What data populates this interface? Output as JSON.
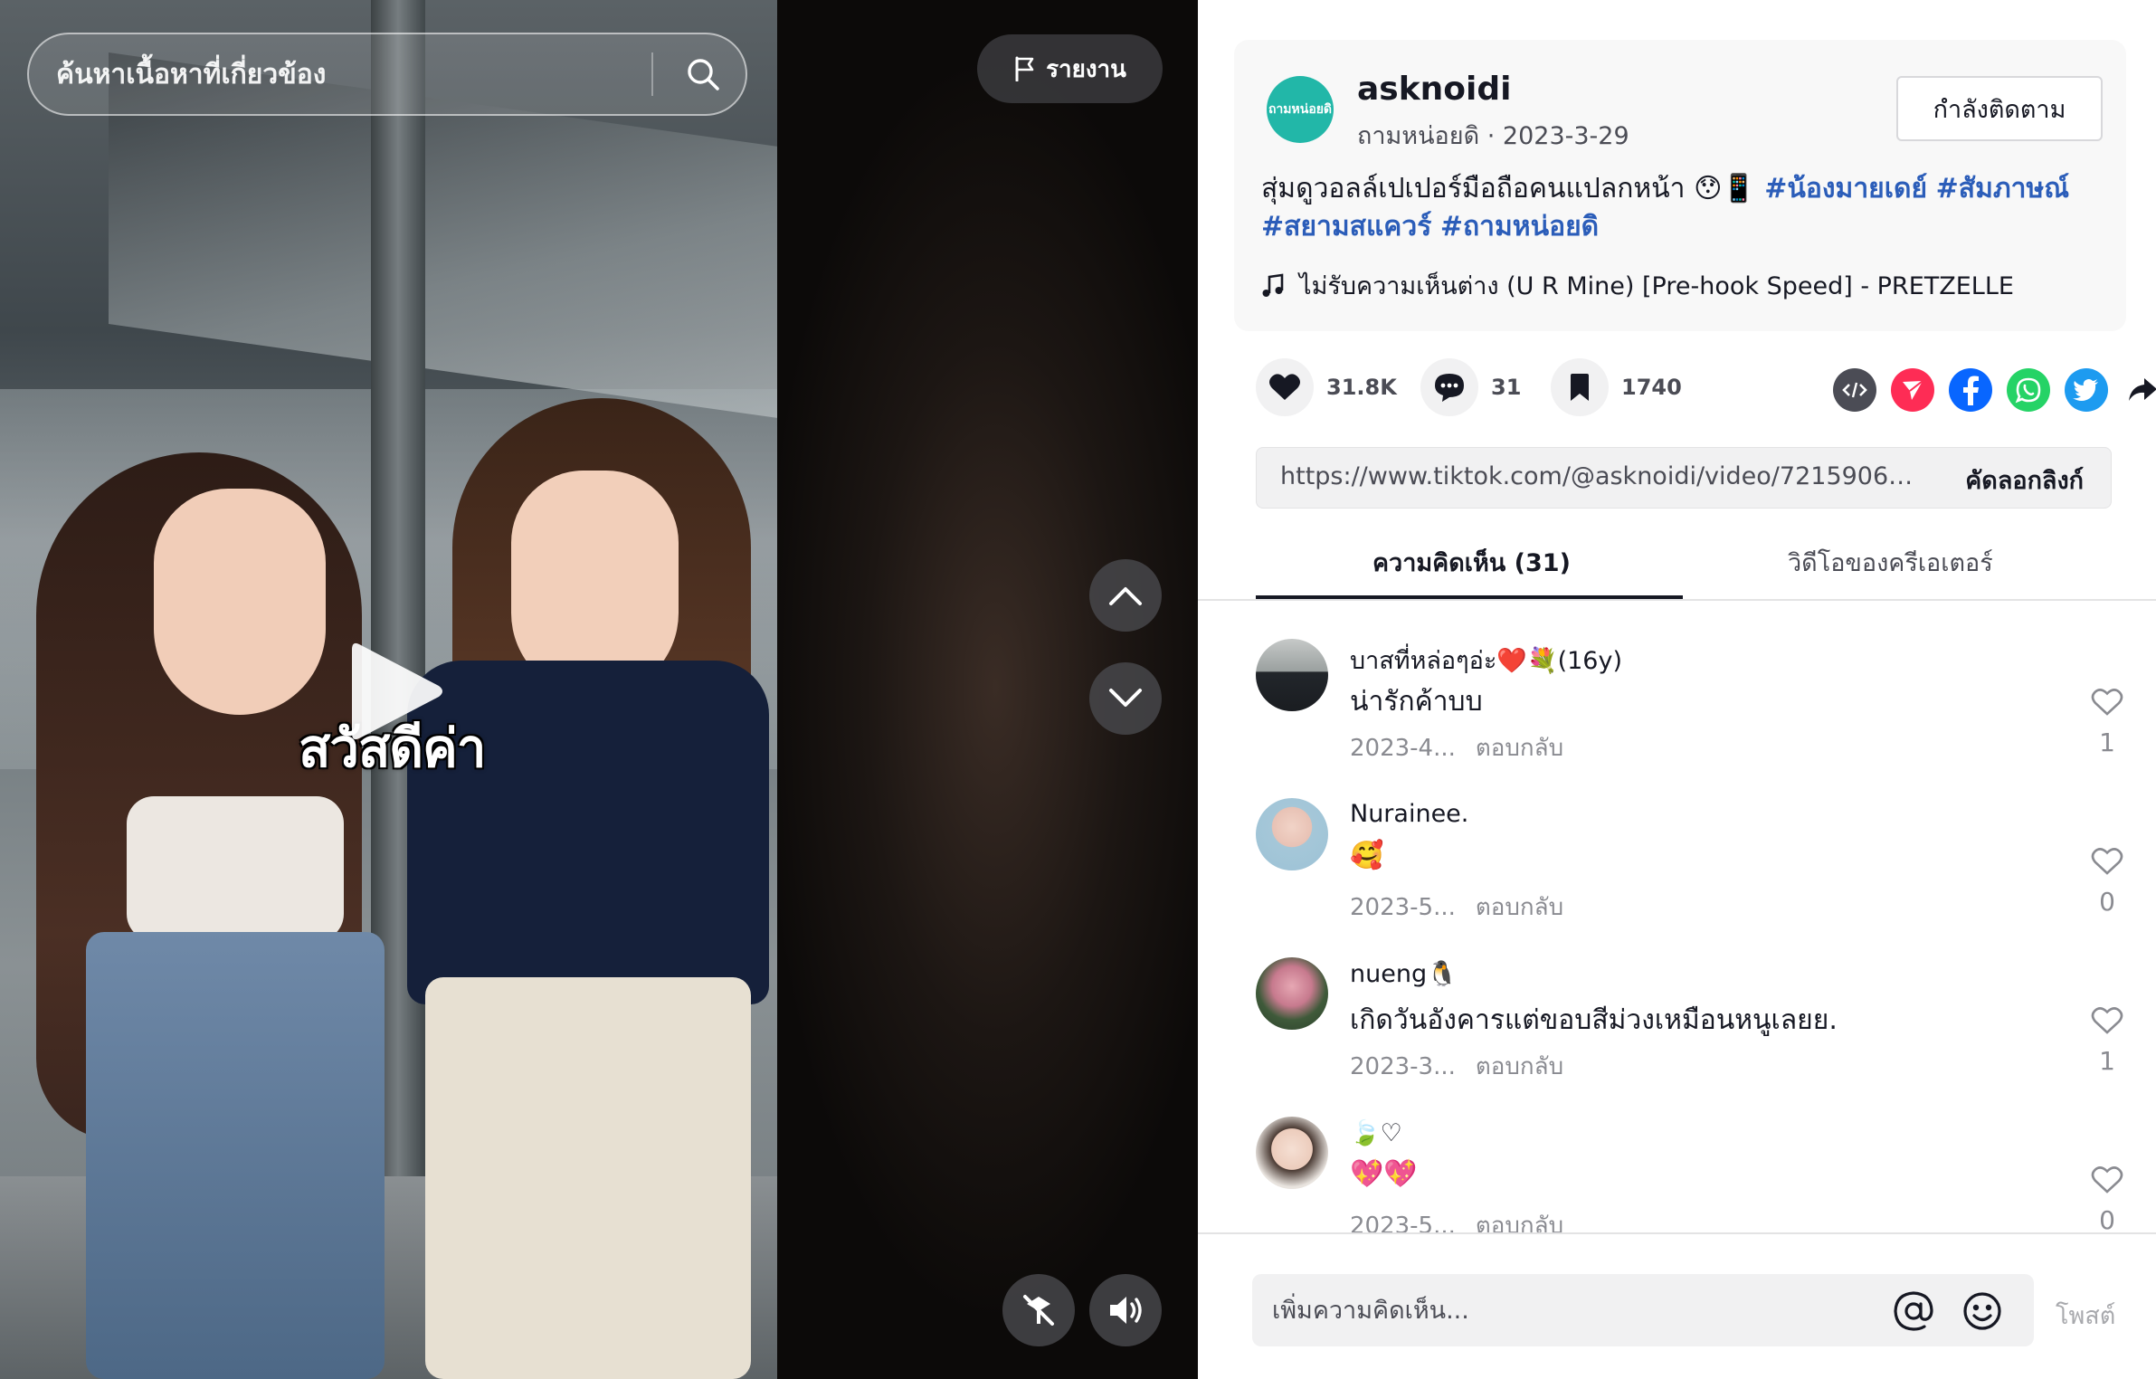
{
  "video": {
    "search_placeholder": "ค้นหาเนื้อหาที่เกี่ยวข้อง",
    "report_label": "รายงาน",
    "caption_overlay": "สวัสดีค่า"
  },
  "author": {
    "avatar_text": "ถามหน่อยดิ",
    "username": "asknoidi",
    "display_name": "ถามหน่อยดิ",
    "date": "2023-3-29",
    "follow_label": "กำลังติดตาม"
  },
  "post": {
    "description_text": "สุ่มดูวอลล์เปเปอร์มือถือคนแปลกหน้า 😯📱",
    "hashtags": [
      "#น้องมายเดย์",
      "#สัมภาษณ์",
      "#สยามสแควร์",
      "#ถามหน่อยดิ"
    ],
    "music": "ไม่รับความเห็นต่าง (U R Mine) [Pre-hook Speed] - PRETZELLE"
  },
  "stats": {
    "likes": "31.8K",
    "comments": "31",
    "saves": "1740"
  },
  "share": {
    "icons": [
      "embed-icon",
      "send-icon",
      "facebook-icon",
      "whatsapp-icon",
      "twitter-icon",
      "share-arrow-icon"
    ],
    "colors": {
      "send": "#fe2c55",
      "facebook": "#0866ff",
      "whatsapp": "#25d366",
      "twitter": "#1d9bf0"
    }
  },
  "link": {
    "url": "https://www.tiktok.com/@asknoidi/video/721590657...",
    "copy_label": "คัดลอกลิงก์"
  },
  "tabs": {
    "comments": "ความคิดเห็น (31)",
    "creator_videos": "วิดีโอของครีเอเตอร์"
  },
  "comments": [
    {
      "user": "บาสที่หล่อๆอ่ะ❤️💐(16y)",
      "text": "น่ารักค้าบบ",
      "date": "2023-4...",
      "reply": "ตอบกลับ",
      "likes": "1"
    },
    {
      "user": "Nurainee.",
      "text": "🥰",
      "date": "2023-5...",
      "reply": "ตอบกลับ",
      "likes": "0"
    },
    {
      "user": "nueng🐧",
      "text": "เกิดวันอังคารแต่ขอบสีม่วงเหมือนหนูเลยย.",
      "date": "2023-3...",
      "reply": "ตอบกลับ",
      "likes": "1"
    },
    {
      "user": "🍃♡",
      "text": "💖💖",
      "date": "2023-5...",
      "reply": "ตอบกลับ",
      "likes": "0"
    }
  ],
  "comment_box": {
    "placeholder": "เพิ่มความคิดเห็น...",
    "post_label": "โพสต์"
  },
  "colors": {
    "hashtag": "#2b5db9",
    "accent": "#fe2c55",
    "avatar_brand": "#22b7a8"
  }
}
